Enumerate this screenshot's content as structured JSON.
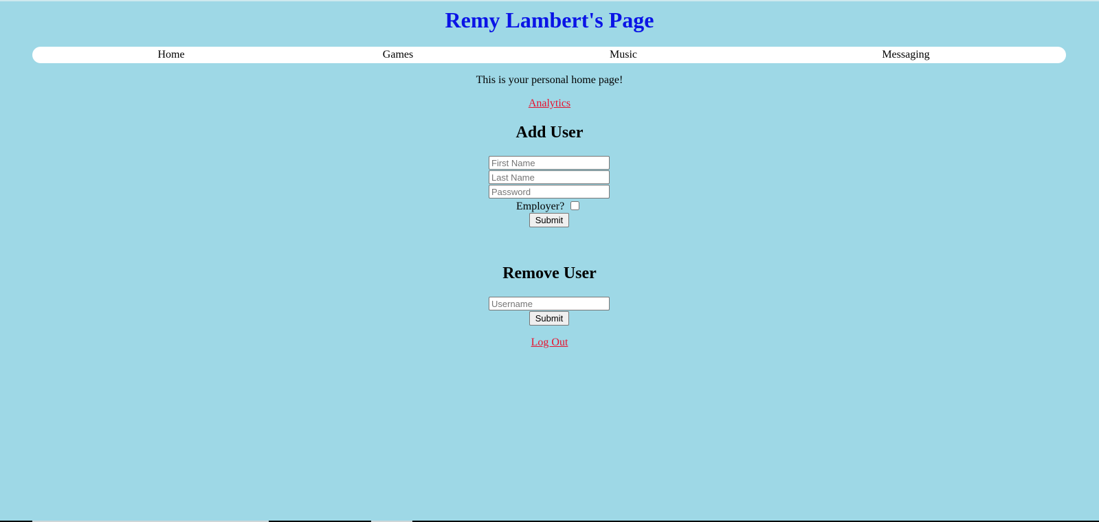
{
  "page": {
    "title": "Remy Lambert's Page",
    "intro": "This is your personal home page!",
    "analytics_link": "Analytics",
    "logout_link": "Log Out"
  },
  "nav": {
    "items": [
      {
        "label": "Home"
      },
      {
        "label": "Games"
      },
      {
        "label": "Music"
      },
      {
        "label": "Messaging"
      }
    ]
  },
  "add_user": {
    "heading": "Add User",
    "first_name_placeholder": "First Name",
    "last_name_placeholder": "Last Name",
    "password_placeholder": "Password",
    "employer_label": "Employer?",
    "employer_checked": false,
    "submit_label": "Submit"
  },
  "remove_user": {
    "heading": "Remove User",
    "username_placeholder": "Username",
    "submit_label": "Submit"
  },
  "colors": {
    "background": "#9ed8e6",
    "title": "#0a14e6",
    "link": "#e8112d",
    "navbar": "#ffffff"
  }
}
